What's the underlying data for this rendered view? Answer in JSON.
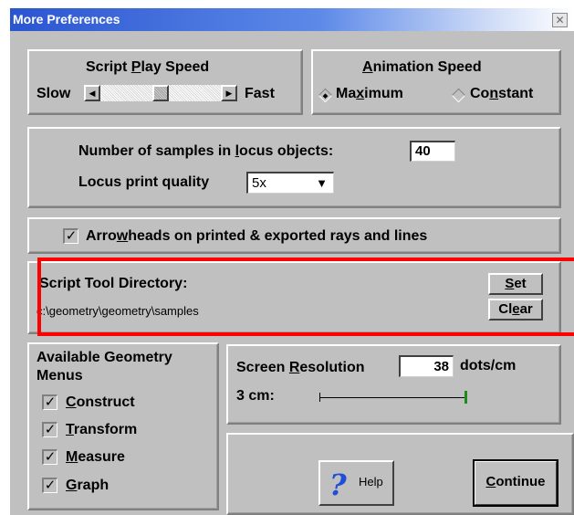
{
  "window": {
    "title": "More Preferences"
  },
  "script_play_speed": {
    "title_pre": "Script ",
    "title_u": "P",
    "title_post": "lay Speed",
    "slow_label": "Slow",
    "fast_label": "Fast",
    "position_fraction": 0.45
  },
  "animation_speed": {
    "title_u": "A",
    "title_post": "nimation Speed",
    "options": [
      {
        "pre": "Ma",
        "u": "x",
        "post": "imum",
        "selected": true
      },
      {
        "pre": "Co",
        "u": "n",
        "post": "stant",
        "selected": false
      }
    ]
  },
  "locus": {
    "samples_label_pre": "Number of samples in ",
    "samples_label_u": "l",
    "samples_label_post": "ocus objects:",
    "samples_value": "40",
    "quality_label": "Locus print quality",
    "quality_value": "5x"
  },
  "arrowheads": {
    "checked": true,
    "label_pre": "Arro",
    "label_u": "w",
    "label_post": "heads on printed & exported rays and lines"
  },
  "script_dir": {
    "title": "Script Tool Directory:",
    "path": "c:\\geometry\\geometry\\samples",
    "set_u": "S",
    "set_post": "et",
    "clear_pre": "Cl",
    "clear_u": "e",
    "clear_post": "ar"
  },
  "menus": {
    "title_line1": "Available Geometry",
    "title_line2": "Menus",
    "items": [
      {
        "u": "C",
        "post": "onstruct",
        "checked": true
      },
      {
        "u": "T",
        "post": "ransform",
        "checked": true
      },
      {
        "u": "M",
        "post": "easure",
        "checked": true
      },
      {
        "u": "G",
        "post": "raph",
        "checked": true
      }
    ]
  },
  "resolution": {
    "label_pre": "Screen ",
    "label_u": "R",
    "label_post": "esolution",
    "value": "38",
    "unit": "dots/cm",
    "sample_label": "3 cm:"
  },
  "buttons": {
    "help_label": "Help",
    "continue_u": "C",
    "continue_post": "ontinue"
  },
  "colors": {
    "highlight": "#ff0000",
    "face": "#c0c0c0"
  }
}
